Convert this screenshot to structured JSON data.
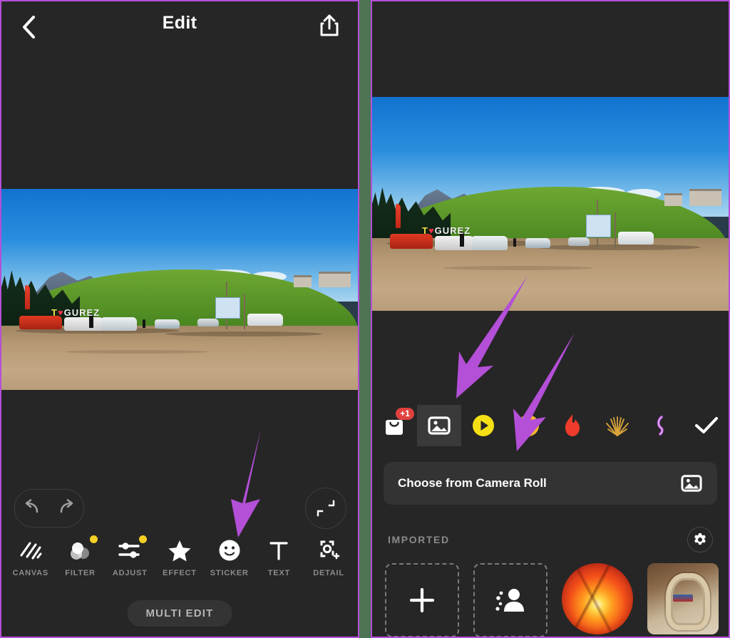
{
  "app": {
    "accent_purple": "#b44fd8",
    "panel_bg": "#262626",
    "gap_color": "#4e7355",
    "badge_red": "#e0413f",
    "dot_yellow": "#f5d024"
  },
  "left_panel": {
    "header": {
      "title": "Edit",
      "back_icon": "chevron-left-icon",
      "share_icon": "share-icon"
    },
    "photo": {
      "alt": "I ♥ GUREZ hillside landscape with cars and mountains",
      "sign_text_1": "T",
      "sign_heart": "♥",
      "sign_text_2": "GUREZ"
    },
    "history": {
      "undo_icon": "undo-icon",
      "redo_icon": "redo-icon",
      "fullscreen_icon": "collapse-icon"
    },
    "tools": [
      {
        "label": "CANVAS",
        "icon": "canvas-icon",
        "badge": false
      },
      {
        "label": "FILTER",
        "icon": "filter-icon",
        "badge": true
      },
      {
        "label": "ADJUST",
        "icon": "adjust-icon",
        "badge": true
      },
      {
        "label": "EFFECT",
        "icon": "star-icon",
        "badge": false
      },
      {
        "label": "STICKER",
        "icon": "smiley-icon",
        "badge": false
      },
      {
        "label": "TEXT",
        "icon": "text-icon",
        "badge": false
      },
      {
        "label": "DETAIL",
        "icon": "detail-icon",
        "badge": false
      }
    ],
    "multi_edit_label": "MULTI EDIT"
  },
  "right_panel": {
    "photo": {
      "alt": "I ♥ GUREZ hillside landscape with cars and mountains",
      "sign_text_1": "T",
      "sign_heart": "♥",
      "sign_text_2": "GUREZ"
    },
    "categories": [
      {
        "name": "store-tab",
        "icon": "shopping-bag-icon",
        "badge": "+1",
        "selected": false
      },
      {
        "name": "photo-tab",
        "icon": "photo-icon",
        "badge": "",
        "selected": true
      },
      {
        "name": "gif-tab",
        "icon": "play-circle-icon",
        "badge": "",
        "selected": false
      },
      {
        "name": "emoji-tab",
        "icon": "grinning-emoji-icon",
        "badge": "",
        "selected": false
      },
      {
        "name": "flame-tab",
        "icon": "flame-icon",
        "badge": "",
        "selected": false
      },
      {
        "name": "firework-tab",
        "icon": "firework-icon",
        "badge": "",
        "selected": false
      },
      {
        "name": "neon-tab",
        "icon": "neon-sticker-icon",
        "badge": "",
        "selected": false
      }
    ],
    "confirm_icon": "checkmark-icon",
    "camera_roll": {
      "label": "Choose from Camera Roll",
      "icon": "photo-icon"
    },
    "imported": {
      "label": "IMPORTED",
      "settings_icon": "gear-icon",
      "items": [
        {
          "name": "add-sticker",
          "icon": "plus-icon",
          "type": "dashed"
        },
        {
          "name": "cutout-sticker",
          "icon": "person-cutout-icon",
          "type": "dashed"
        },
        {
          "name": "glowing-ball-sticker",
          "icon": "",
          "type": "image"
        },
        {
          "name": "rope-basket-sticker",
          "icon": "",
          "type": "image"
        }
      ]
    }
  },
  "annotations": [
    {
      "name": "arrow-to-sticker-tool",
      "target": "STICKER"
    },
    {
      "name": "arrow-to-photo-category",
      "target": "photo-tab"
    },
    {
      "name": "arrow-to-camera-roll",
      "target": "Choose from Camera Roll"
    }
  ]
}
